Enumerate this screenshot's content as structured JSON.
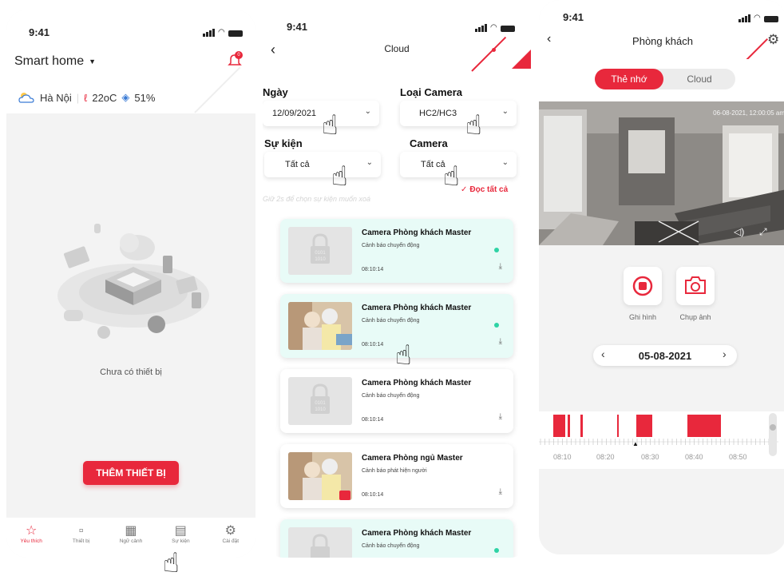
{
  "status": {
    "time": "9:41"
  },
  "home": {
    "title": "Smart home",
    "notification_count": "0",
    "city": "Hà Nội",
    "temperature": "22oC",
    "humidity": "51%",
    "empty_text": "Chưa có thiết bị",
    "add_button": "THÊM THIẾT BỊ",
    "tabs": [
      {
        "label": "Yêu thích",
        "icon": "star-icon"
      },
      {
        "label": "Thiết bị",
        "icon": "device-icon"
      },
      {
        "label": "Ngữ cảnh",
        "icon": "scene-icon"
      },
      {
        "label": "Sự kiện",
        "icon": "event-icon"
      },
      {
        "label": "Cài đặt",
        "icon": "gear-icon"
      }
    ]
  },
  "cloud": {
    "title": "Cloud",
    "date_label": "Ngày",
    "date_value": "12/09/2021",
    "camera_type_label": "Loại Camera",
    "camera_type_value": "HC2/HC3",
    "event_label": "Sự kiện",
    "event_value": "Tất cả",
    "camera_label": "Camera",
    "camera_value": "Tất cả",
    "hint": "Giữ 2s để chọn sự kiện muốn xoá",
    "read_all": "Đọc tất cả",
    "events": [
      {
        "title": "Camera Phòng khách Master",
        "desc": "Cảnh báo chuyển động",
        "time": "08:10:14",
        "unread": true,
        "thumb": "placeholder"
      },
      {
        "title": "Camera Phòng khách Master",
        "desc": "Cảnh báo chuyển động",
        "time": "08:10:14",
        "unread": true,
        "thumb": "photo"
      },
      {
        "title": "Camera Phòng khách Master",
        "desc": "Cảnh báo chuyển động",
        "time": "08:10:14",
        "unread": false,
        "thumb": "placeholder"
      },
      {
        "title": "Camera Phòng ngủ Master",
        "desc": "Cảnh báo phát hiện người",
        "time": "08:10:14",
        "unread": false,
        "thumb": "photo"
      },
      {
        "title": "Camera Phòng khách Master",
        "desc": "Cảnh báo chuyển động",
        "time": "",
        "unread": true,
        "thumb": "placeholder"
      }
    ]
  },
  "camera": {
    "title": "Phòng khách",
    "tab_memory": "Thẻ nhớ",
    "tab_cloud": "Cloud",
    "video_timestamp": "06-08-2021, 12:00:05 am",
    "record_label": "Ghi hình",
    "snapshot_label": "Chụp ảnh",
    "date": "05-08-2021",
    "timeline_ticks": [
      "08:10",
      "08:20",
      "08:30",
      "08:40",
      "08:50"
    ]
  },
  "colors": {
    "accent": "#e8283c",
    "unread_bg": "#e8fbf7",
    "unread_dot": "#2ed3a5"
  }
}
